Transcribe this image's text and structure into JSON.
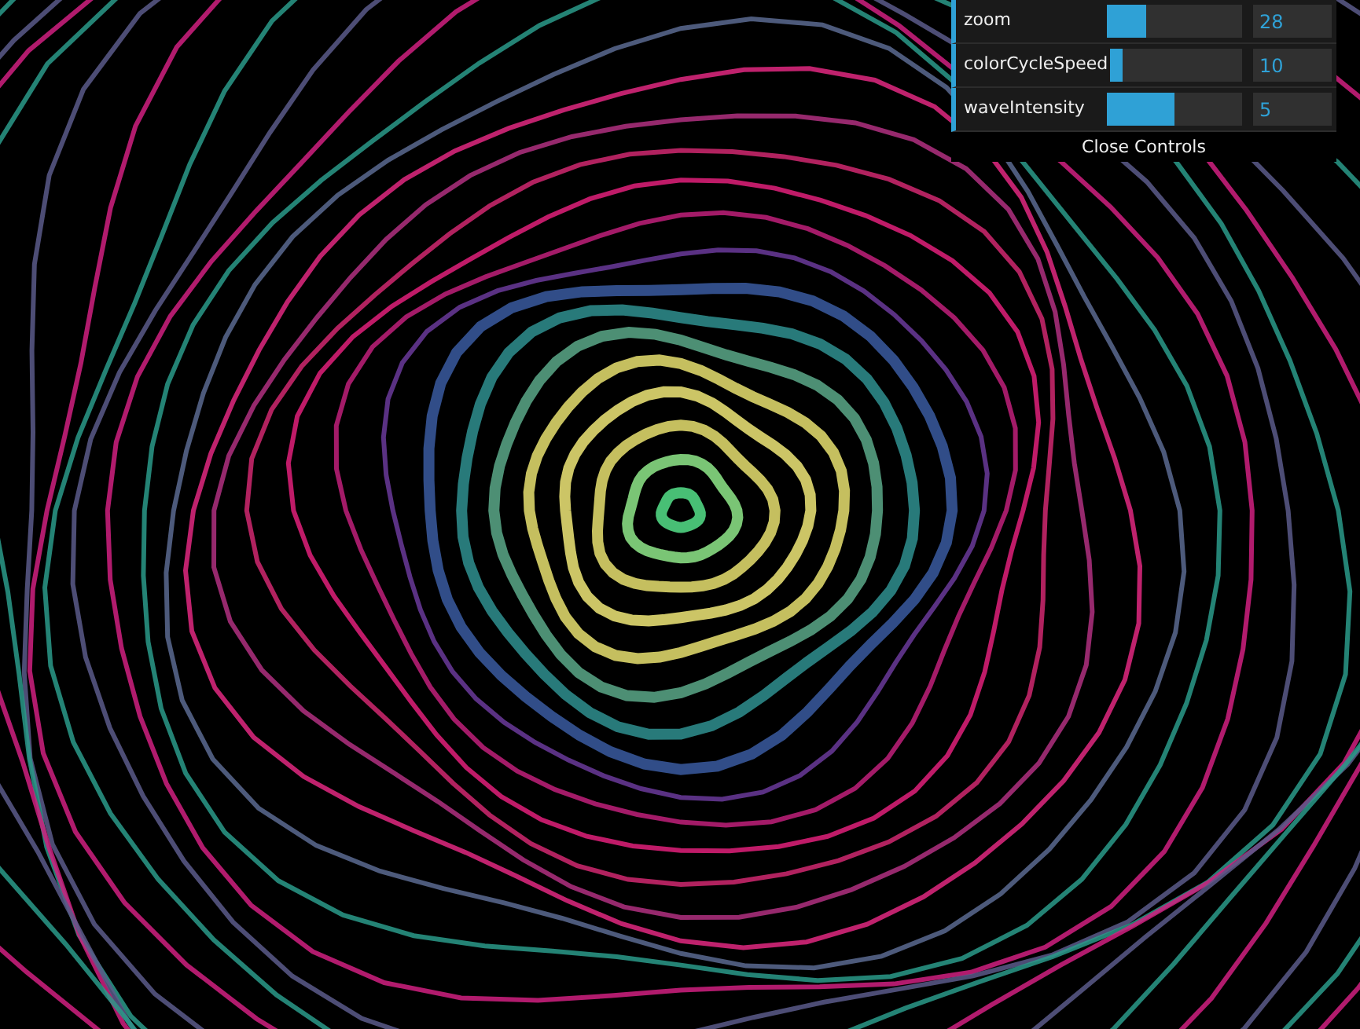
{
  "controls": [
    {
      "label": "zoom",
      "level": 0.29,
      "value": "28"
    },
    {
      "label": "colorCycleSpeed",
      "level": 0.09,
      "value": "10"
    },
    {
      "label": "waveIntensity",
      "level": 0.5,
      "value": "5"
    }
  ],
  "close_button": "Close Controls"
}
